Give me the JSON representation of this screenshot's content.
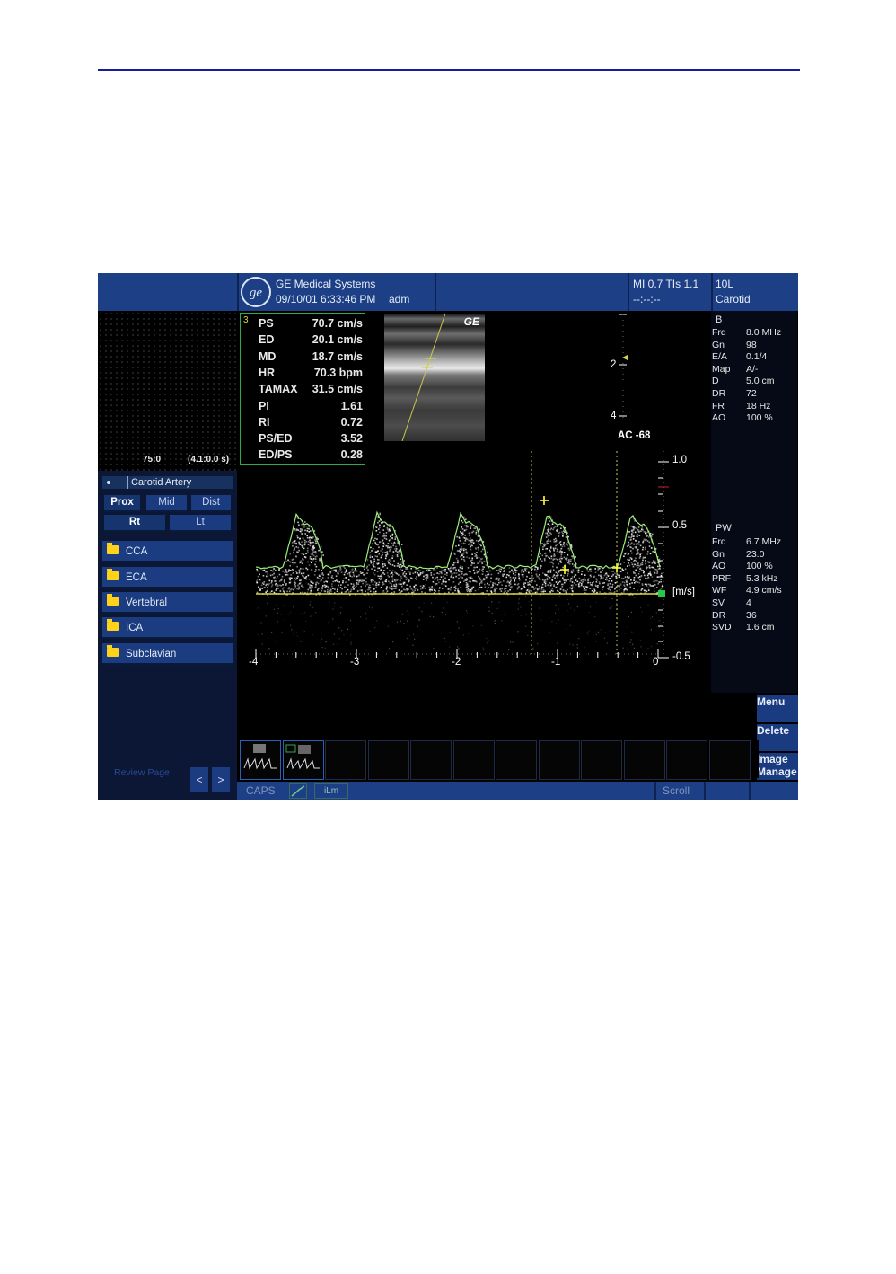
{
  "header": {
    "company": "GE Medical Systems",
    "datetime": "09/10/01 6:33:46 PM",
    "user": "adm",
    "mi_tis": "MI 0.7 TIs 1.1",
    "timer": "--:--:--",
    "probe": "10L",
    "application": "Carotid"
  },
  "cine": {
    "frame": "75:0",
    "timespan": "(4.1:0.0 s)"
  },
  "protocol": {
    "title": "Carotid Artery",
    "segments": [
      "Prox",
      "Mid",
      "Dist"
    ],
    "sides": [
      "Rt",
      "Lt"
    ],
    "folders": [
      "CCA",
      "ECA",
      "Vertebral",
      "ICA",
      "Subclavian"
    ],
    "review_label": "Review Page",
    "prev": "<",
    "next": ">"
  },
  "measurements": {
    "index": "3",
    "rows": [
      {
        "label": "PS",
        "value": "70.7 cm/s"
      },
      {
        "label": "ED",
        "value": "20.1 cm/s"
      },
      {
        "label": "MD",
        "value": "18.7 cm/s"
      },
      {
        "label": "HR",
        "value": "70.3 bpm"
      },
      {
        "label": "TAMAX",
        "value": "31.5 cm/s"
      },
      {
        "label": "PI",
        "value": "1.61"
      },
      {
        "label": "RI",
        "value": "0.72"
      },
      {
        "label": "PS/ED",
        "value": "3.52"
      },
      {
        "label": "ED/PS",
        "value": "0.28"
      }
    ]
  },
  "image": {
    "logo": "GE",
    "depth_2": "2",
    "depth_4": "4",
    "angle": "AC -68"
  },
  "spectral": {
    "vel_labels": [
      "1.0",
      "0.5",
      "-0.5"
    ],
    "unit": "[m/s]",
    "time_labels": [
      "-4",
      "-3",
      "-2",
      "-1",
      "0"
    ],
    "accent": "#9cf07a"
  },
  "params_b": {
    "mode": "B",
    "rows": [
      {
        "k": "Frq",
        "v": "8.0 MHz"
      },
      {
        "k": "Gn",
        "v": "98"
      },
      {
        "k": "E/A",
        "v": "0.1/4"
      },
      {
        "k": "Map",
        "v": "A/-"
      },
      {
        "k": "D",
        "v": "5.0 cm"
      },
      {
        "k": "DR",
        "v": "72"
      },
      {
        "k": "FR",
        "v": "18 Hz"
      },
      {
        "k": "AO",
        "v": "100 %"
      }
    ]
  },
  "params_pw": {
    "mode": "PW",
    "rows": [
      {
        "k": "Frq",
        "v": "6.7 MHz"
      },
      {
        "k": "Gn",
        "v": "23.0"
      },
      {
        "k": "AO",
        "v": "100 %"
      },
      {
        "k": "PRF",
        "v": "5.3 kHz"
      },
      {
        "k": "WF",
        "v": "4.9 cm/s"
      },
      {
        "k": "SV",
        "v": "4"
      },
      {
        "k": "DR",
        "v": "36"
      },
      {
        "k": "SVD",
        "v": "1.6 cm"
      }
    ]
  },
  "softkeys": {
    "menu": "Menu",
    "delete": "Delete",
    "image_manage": "Image Manage"
  },
  "statusbar": {
    "caps": "CAPS",
    "ilm": "iLm",
    "scroll": "Scroll"
  }
}
